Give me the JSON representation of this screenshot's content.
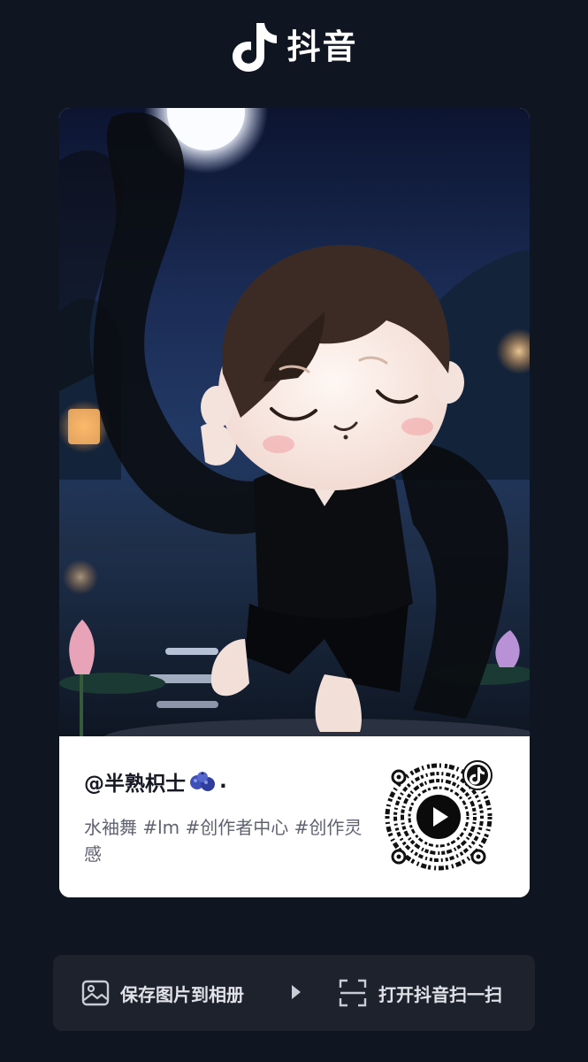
{
  "header": {
    "brand_name": "抖音",
    "logo_icon": "douyin-note-icon"
  },
  "card": {
    "image_description_icon": "dancing-plush-doll-image",
    "username": "@半熟枳士",
    "username_suffix": ".",
    "username_emoji_icon": "blueberries-icon",
    "caption": "水袖舞 #lm #创作者中心 #创作灵感",
    "qr_icon": "douyin-qr-code-icon"
  },
  "actions": {
    "save": {
      "label": "保存图片到相册",
      "icon": "image-icon"
    },
    "divider_icon": "play-triangle-icon",
    "scan": {
      "label": "打开抖音扫一扫",
      "icon": "scan-frame-icon"
    }
  },
  "colors": {
    "background": "#0f1521",
    "card_bg": "#ffffff",
    "action_bar_bg": "#1d222d",
    "text_dark": "#161823",
    "text_muted": "#5f6270"
  }
}
